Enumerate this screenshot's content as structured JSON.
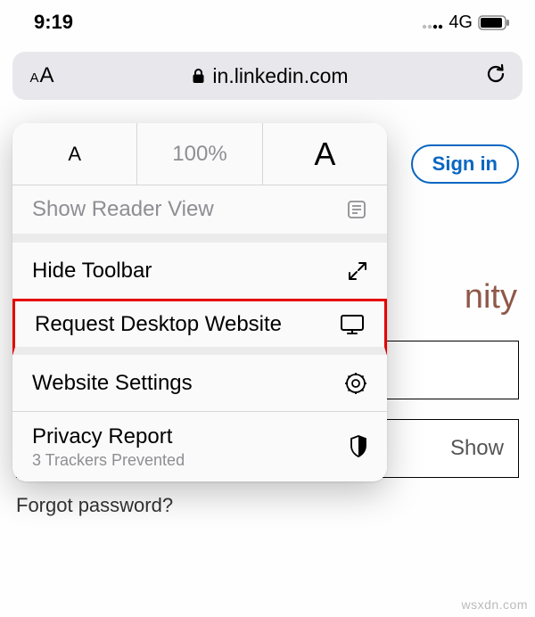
{
  "status": {
    "time": "9:19",
    "network": "4G"
  },
  "urlbar": {
    "domain": "in.linkedin.com"
  },
  "page": {
    "signin": "Sign in",
    "community_fragment": "nity",
    "show": "Show",
    "forgot": "Forgot password?"
  },
  "popover": {
    "zoom": {
      "pct": "100%"
    },
    "reader": {
      "label": "Show Reader View"
    },
    "hidetoolbar": {
      "label": "Hide Toolbar"
    },
    "desktop": {
      "label": "Request Desktop Website"
    },
    "settings": {
      "label": "Website Settings"
    },
    "privacy": {
      "label": "Privacy Report",
      "sub": "3 Trackers Prevented"
    }
  },
  "watermark": "wsxdn.com"
}
